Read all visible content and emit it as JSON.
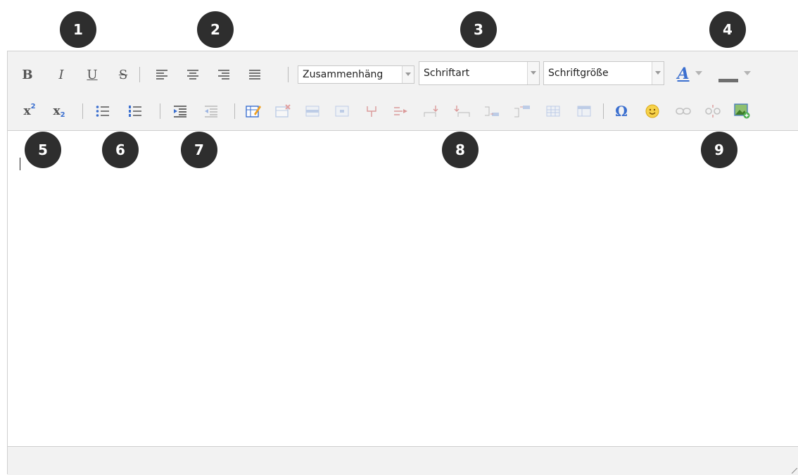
{
  "markers": [
    "1",
    "2",
    "3",
    "4",
    "5",
    "6",
    "7",
    "8",
    "9"
  ],
  "toolbar": {
    "row1": {
      "bold_label": "B",
      "italic_label": "I",
      "underline_label": "U",
      "strike_label": "S",
      "format_select": "Zusammenhäng",
      "font_select": "Schriftart",
      "size_select": "Schriftgröße",
      "text_color_label": "A"
    },
    "row2": {
      "superscript_label": "x",
      "superscript_exp": "2",
      "subscript_label": "x",
      "subscript_exp": "2",
      "special_char_label": "Ω"
    }
  },
  "colors": {
    "accent_blue": "#3b6fcf",
    "marker_bg": "#2e2e2e",
    "toolbar_bg": "#f2f2f2"
  }
}
